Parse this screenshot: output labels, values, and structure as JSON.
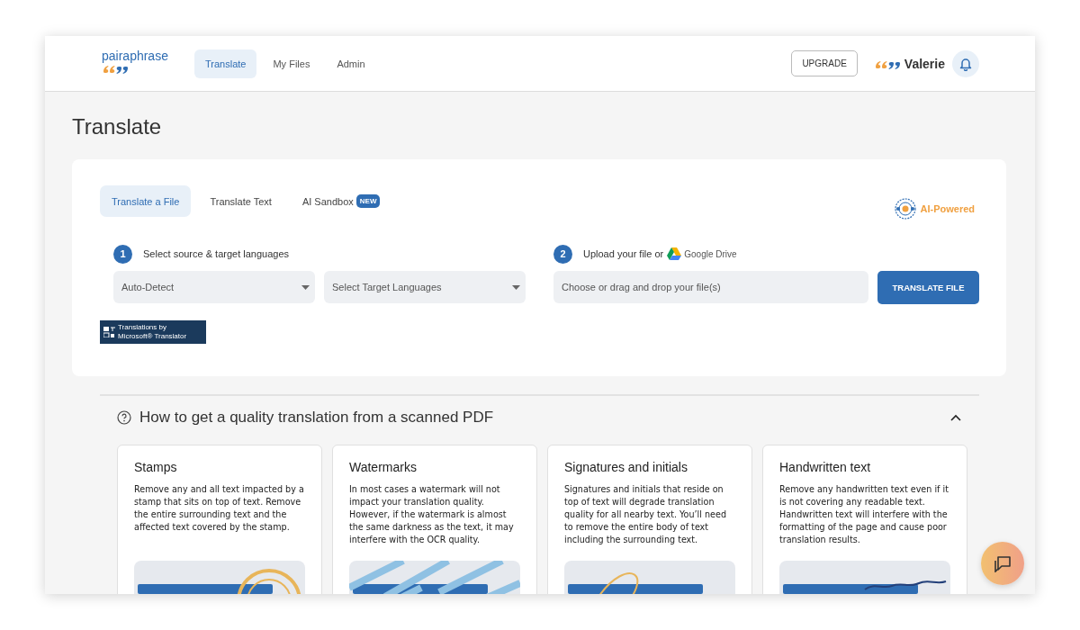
{
  "header": {
    "logo": "pairaphrase",
    "nav": [
      {
        "label": "Translate",
        "selected": true
      },
      {
        "label": "My Files",
        "selected": false
      },
      {
        "label": "Admin",
        "selected": false
      }
    ],
    "upgrade_button": "UPGRADE",
    "user_name": "Valerie"
  },
  "page_title": "Translate",
  "translate_panel": {
    "tabs": [
      {
        "label": "Translate a File",
        "selected": true
      },
      {
        "label": "Translate Text",
        "selected": false
      },
      {
        "label": "AI Sandbox",
        "selected": false,
        "badge": "NEW"
      }
    ],
    "ai_badge": "AI-Powered",
    "step_1": {
      "number": "1",
      "label": "Select source & target languages",
      "source_select": "Auto-Detect",
      "target_select": "Select Target Languages"
    },
    "step_2": {
      "number": "2",
      "label": "Upload your file or",
      "drive_label": "Google Drive",
      "file_field": {
        "placeholder": "Choose or drag and drop your file(s)"
      },
      "button": "TRANSLATE FILE"
    },
    "attribution": [
      "Translations by",
      "Microsoft® Translator"
    ]
  },
  "help_section": {
    "title": "How to get a quality translation from a scanned PDF",
    "expanded": true,
    "cards": [
      {
        "title": "Stamps",
        "body": "Remove any and all text impacted by a stamp that sits on top of text. Remove the entire surrounding text and the affected text covered by the stamp."
      },
      {
        "title": "Watermarks",
        "body": "In most cases a watermark will not impact your translation quality. However, if the watermark is almost the same darkness as the text, it may interfere with the OCR quality."
      },
      {
        "title": "Signatures and initials",
        "body": "Signatures and initials that reside on top of text will degrade translation quality for all nearby text. You’ll need to remove the entire body of text including the surrounding text."
      },
      {
        "title": "Handwritten text",
        "body": "Remove any handwritten text even if it is not covering any readable text. Handwritten text will interfere with the formatting of the page and cause poor translation results."
      }
    ]
  }
}
